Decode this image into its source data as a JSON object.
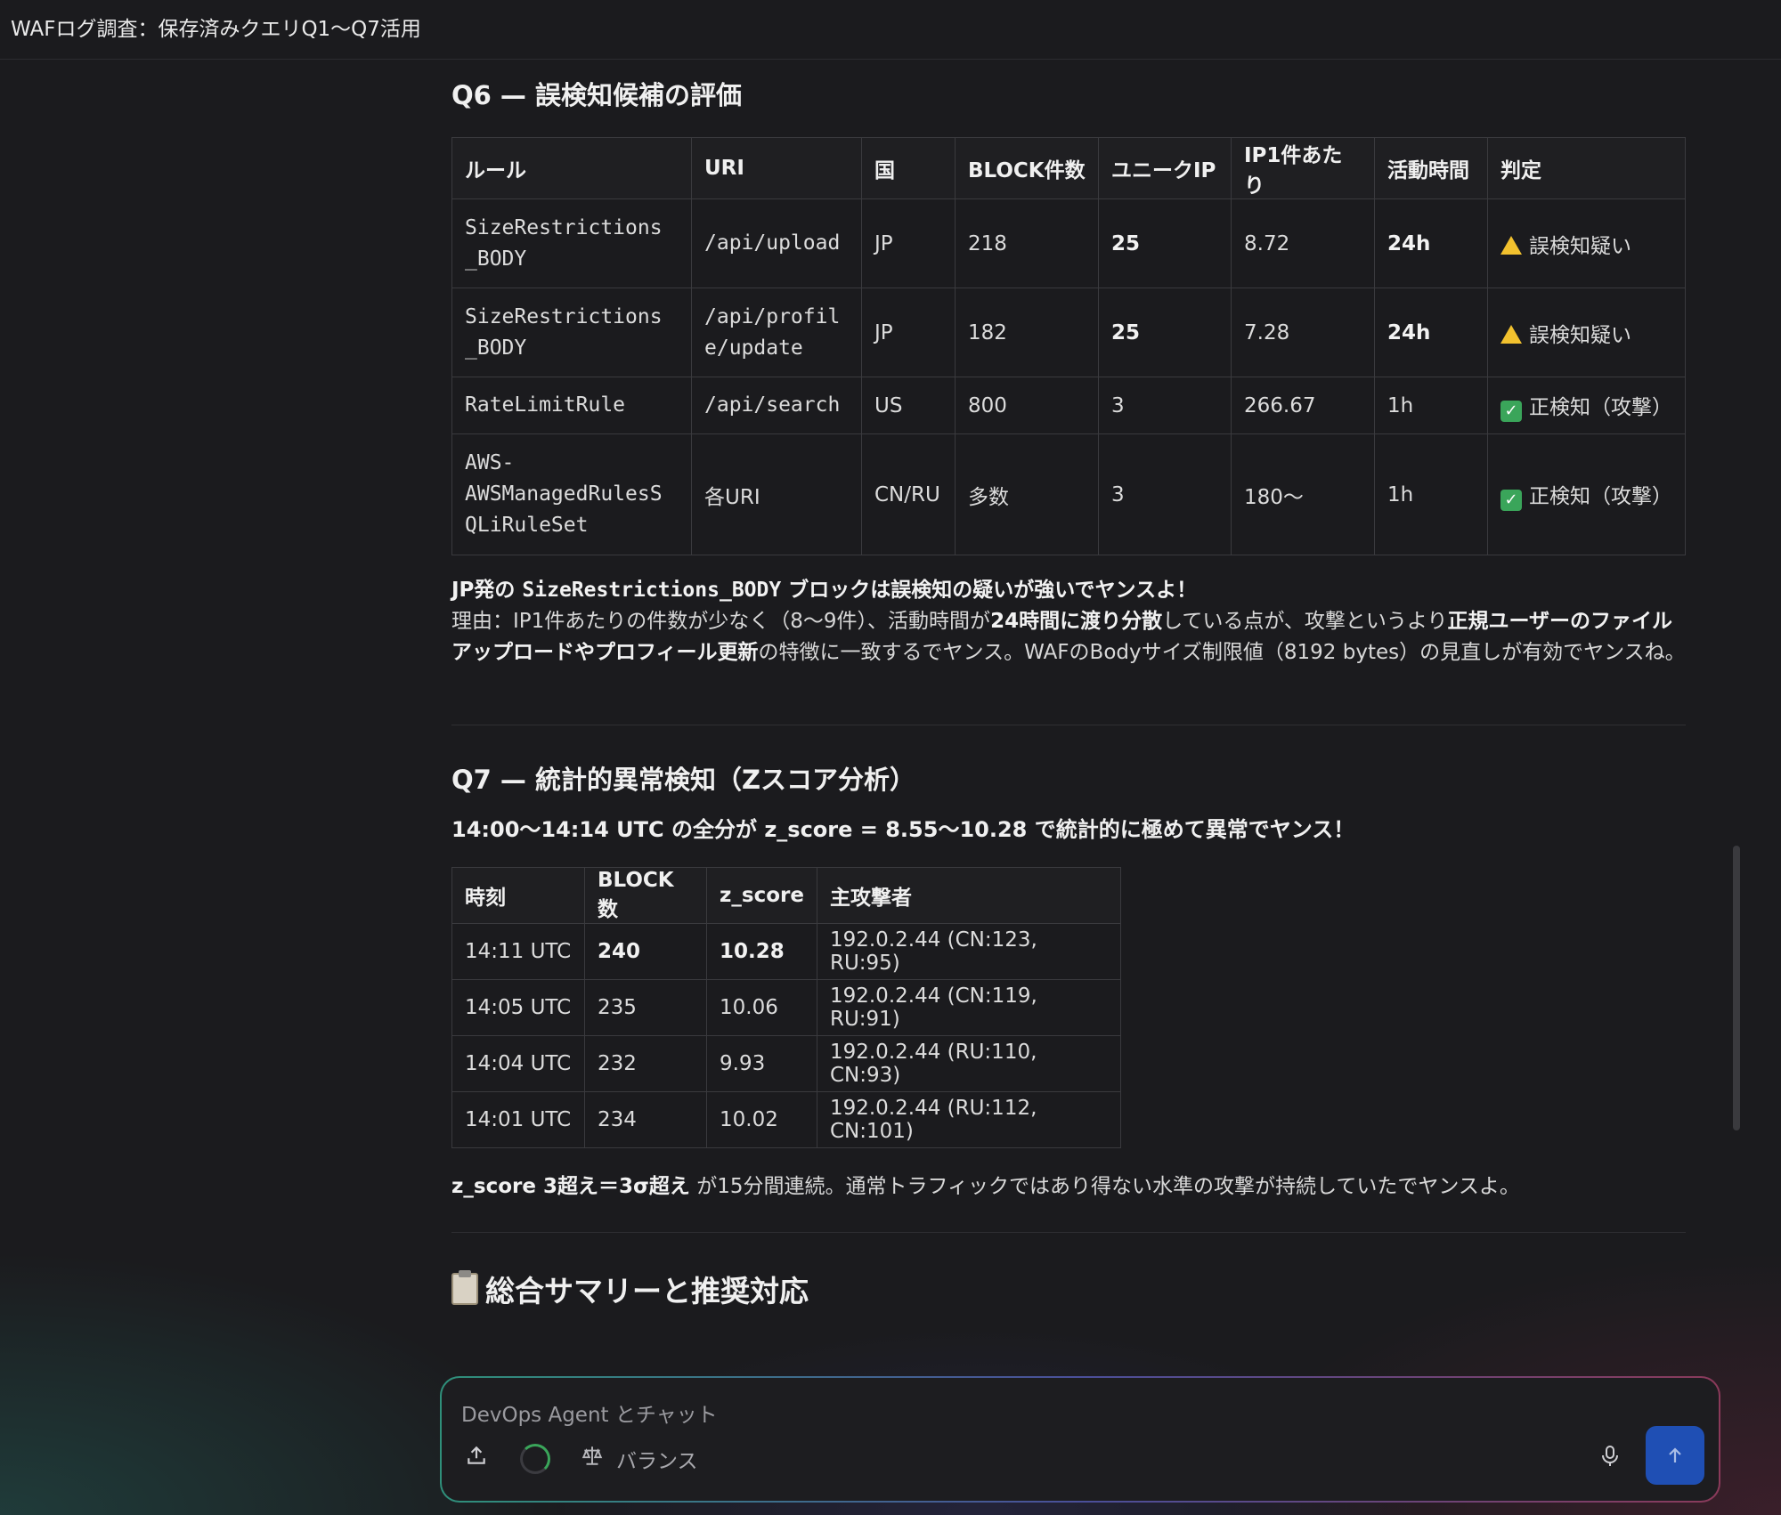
{
  "window": {
    "title": "WAFログ調査：保存済みクエリQ1〜Q7活用"
  },
  "q6": {
    "heading": "Q6 — 誤検知候補の評価",
    "headers": [
      "ルール",
      "URI",
      "国",
      "BLOCK件数",
      "ユニークIP",
      "IP1件あたり",
      "活動時間",
      "判定"
    ],
    "rows": [
      {
        "rule_l1": "SizeRestrictions",
        "rule_l2": "_BODY",
        "rule_l3": "",
        "uri_l1": "/api/upload",
        "uri_l2": "",
        "country": "JP",
        "block": "218",
        "unique_ip": "25",
        "per_ip": "8.72",
        "active": "24h",
        "verdict": "誤検知疑い",
        "verdict_icon": "warning-icon"
      },
      {
        "rule_l1": "SizeRestrictions",
        "rule_l2": "_BODY",
        "rule_l3": "",
        "uri_l1": "/api/profil",
        "uri_l2": "e/update",
        "country": "JP",
        "block": "182",
        "unique_ip": "25",
        "per_ip": "7.28",
        "active": "24h",
        "verdict": "誤検知疑い",
        "verdict_icon": "warning-icon"
      },
      {
        "rule_l1": "RateLimitRule",
        "rule_l2": "",
        "rule_l3": "",
        "uri_l1": "/api/search",
        "uri_l2": "",
        "country": "US",
        "block": "800",
        "unique_ip": "3",
        "per_ip": "266.67",
        "active": "1h",
        "verdict": "正検知（攻撃）",
        "verdict_icon": "check-icon"
      },
      {
        "rule_l1": "AWS-",
        "rule_l2": "AWSManagedRulesS",
        "rule_l3": "QLiRuleSet",
        "uri_l1": "各URI",
        "uri_l2": "",
        "country": "CN/RU",
        "block": "多数",
        "unique_ip": "3",
        "per_ip": "180〜",
        "active": "1h",
        "verdict": "正検知（攻撃）",
        "verdict_icon": "check-icon"
      }
    ],
    "summary": {
      "lead_prefix": "JP発の ",
      "lead_code": "SizeRestrictions_BODY",
      "lead_suffix": " ブロックは誤検知の疑いが強いでヤンスよ！",
      "reason_1": "理由：IP1件あたりの件数が少なく（8〜9件）、活動時間が",
      "reason_bold_1": "24時間に渡り分散",
      "reason_2": "している点が、攻撃というより",
      "reason_bold_2": "正規ユーザーのファイルアップロードやプロフィール更新",
      "reason_3": "の特徴に一致するでヤンス。WAFのBodyサイズ制限値（8192 bytes）の見直しが有効でヤンスね。"
    }
  },
  "q7": {
    "heading": "Q7 — 統計的異常検知（Zスコア分析）",
    "subheading": "14:00〜14:14 UTC の全分が z_score = 8.55〜10.28 で統計的に極めて異常でヤンス！",
    "headers": [
      "時刻",
      "BLOCK数",
      "z_score",
      "主攻撃者"
    ],
    "rows": [
      {
        "time": "14:11 UTC",
        "block": "240",
        "z": "10.28",
        "attacker": "192.0.2.44 (CN:123, RU:95)"
      },
      {
        "time": "14:05 UTC",
        "block": "235",
        "z": "10.06",
        "attacker": "192.0.2.44 (CN:119, RU:91)"
      },
      {
        "time": "14:04 UTC",
        "block": "232",
        "z": "9.93",
        "attacker": "192.0.2.44 (RU:110, CN:93)"
      },
      {
        "time": "14:01 UTC",
        "block": "234",
        "z": "10.02",
        "attacker": "192.0.2.44 (RU:112, CN:101)"
      }
    ],
    "note_bold": "z_score 3超え＝3σ超え",
    "note_rest": " が15分間連続。通常トラフィックではあり得ない水準の攻撃が持続していたでヤンスよ。"
  },
  "summary_heading": {
    "icon": "clipboard-icon",
    "text": "総合サマリーと推奨対応"
  },
  "composer": {
    "placeholder": "DevOps Agent とチャット",
    "mode_label": "バランス"
  },
  "colors": {
    "accent": "#1f4fb4",
    "warning": "#f2c12e",
    "success": "#3aa55a"
  }
}
